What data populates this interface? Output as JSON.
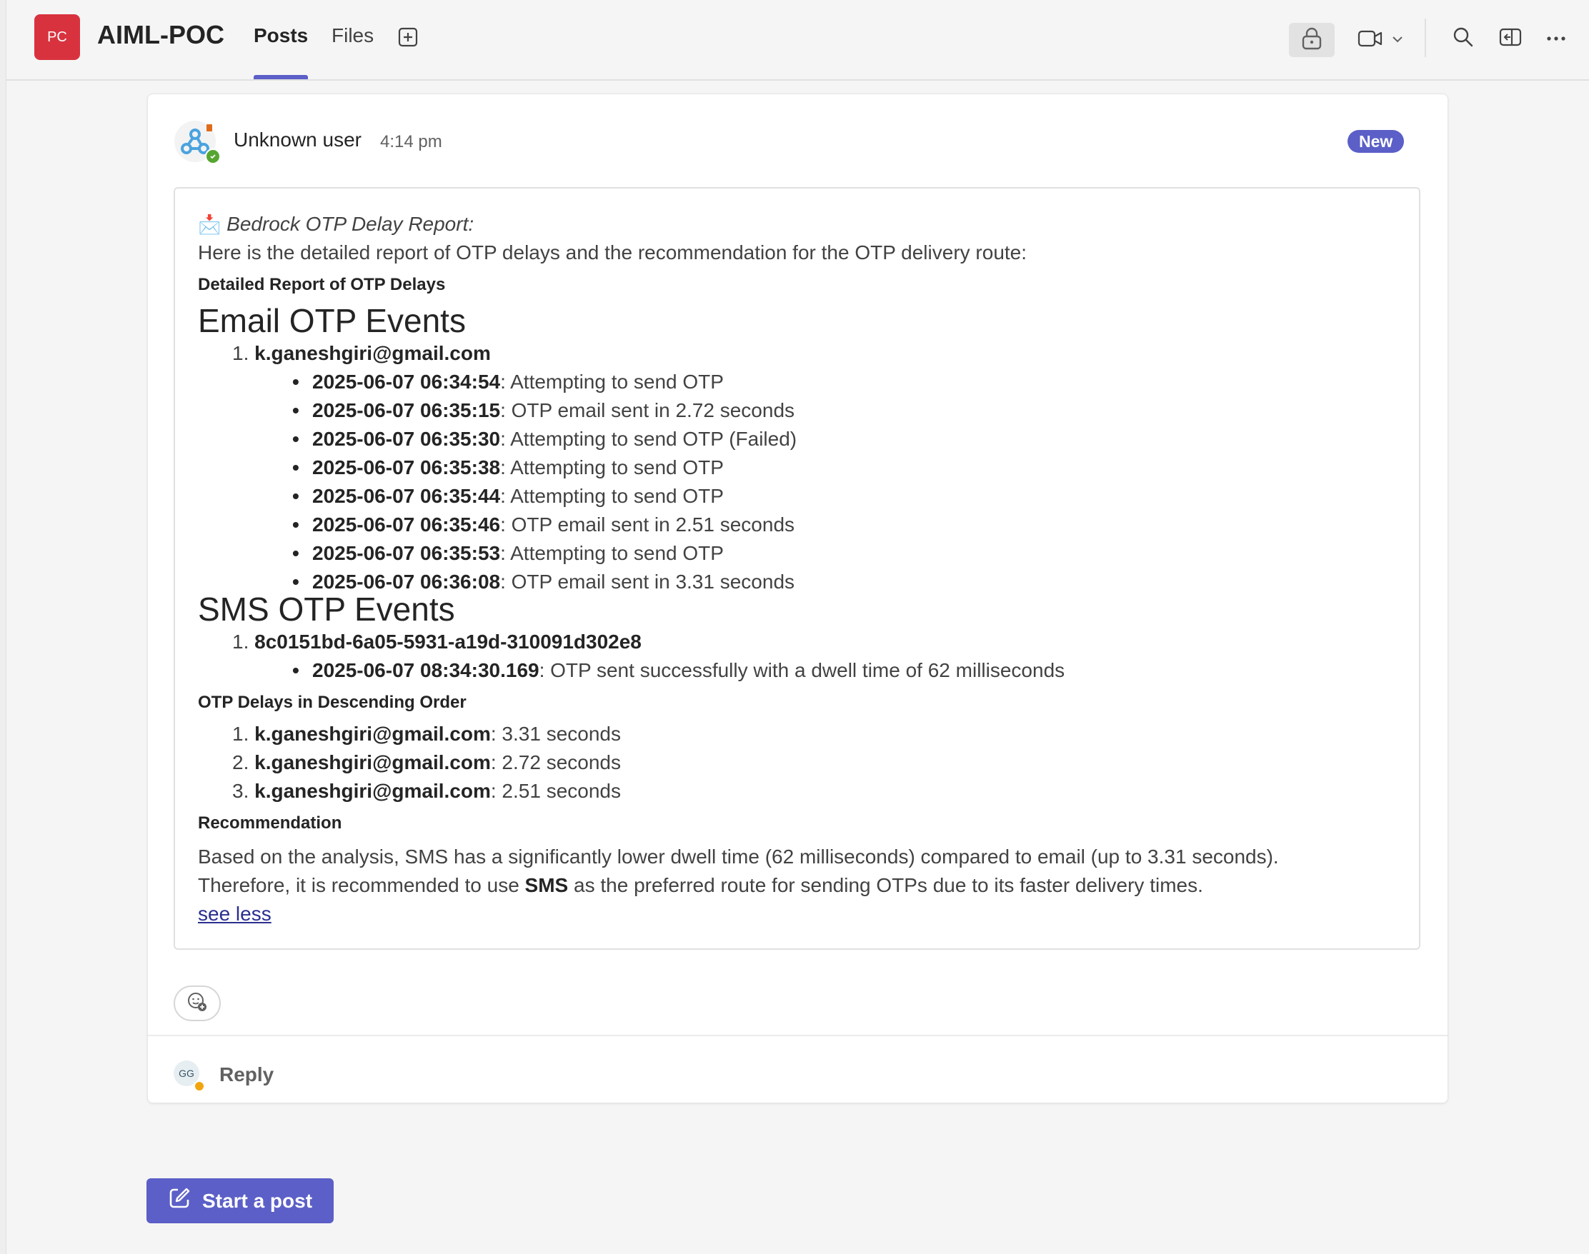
{
  "header": {
    "team_initials": "PC",
    "team_name": "AIML-POC",
    "tabs": [
      {
        "label": "Posts",
        "active": true
      },
      {
        "label": "Files",
        "active": false
      }
    ],
    "icons": [
      "add-tab-icon",
      "lock-icon",
      "video-icon",
      "chevron-down-icon",
      "search-icon",
      "side-panel-icon",
      "more-icon"
    ]
  },
  "post": {
    "author": "Unknown user",
    "time": "4:14 pm",
    "badge": "New",
    "title_emoji": "📩",
    "title": "Bedrock OTP Delay Report:",
    "intro": "Here is the detailed report of OTP delays and the recommendation for the OTP delivery route:",
    "section1_heading": "Detailed Report of OTP Delays",
    "email_heading": "Email OTP Events",
    "email_user_num": "1.",
    "email_user": "k.ganeshgiri@gmail.com",
    "email_events": [
      {
        "ts": "2025-06-07 06:34:54",
        "text": ": Attempting to send OTP"
      },
      {
        "ts": "2025-06-07 06:35:15",
        "text": ": OTP email sent in 2.72 seconds"
      },
      {
        "ts": "2025-06-07 06:35:30",
        "text": ": Attempting to send OTP (Failed)"
      },
      {
        "ts": "2025-06-07 06:35:38",
        "text": ": Attempting to send OTP"
      },
      {
        "ts": "2025-06-07 06:35:44",
        "text": ": Attempting to send OTP"
      },
      {
        "ts": "2025-06-07 06:35:46",
        "text": ": OTP email sent in 2.51 seconds"
      },
      {
        "ts": "2025-06-07 06:35:53",
        "text": ": Attempting to send OTP"
      },
      {
        "ts": "2025-06-07 06:36:08",
        "text": ": OTP email sent in 3.31 seconds"
      }
    ],
    "sms_heading": "SMS OTP Events",
    "sms_id_num": "1.",
    "sms_id": "8c0151bd-6a05-5931-a19d-310091d302e8",
    "sms_event": {
      "ts": "2025-06-07 08:34:30.169",
      "text": ": OTP sent successfully with a dwell time of 62 milliseconds"
    },
    "section2_heading": "OTP Delays in Descending Order",
    "delays": [
      {
        "num": "1.",
        "user": "k.ganeshgiri@gmail.com",
        "value": ": 3.31 seconds"
      },
      {
        "num": "2.",
        "user": "k.ganeshgiri@gmail.com",
        "value": ": 2.72 seconds"
      },
      {
        "num": "3.",
        "user": "k.ganeshgiri@gmail.com",
        "value": ": 2.51 seconds"
      }
    ],
    "section3_heading": "Recommendation",
    "rec_line1": "Based on the analysis, SMS has a significantly lower dwell time (62 milliseconds) compared to email (up to 3.31 seconds).",
    "rec_line2_pre": "Therefore, it is recommended to use ",
    "rec_line2_bold": "SMS",
    "rec_line2_post": " as the preferred route for sending OTPs due to its faster delivery times.",
    "see_less": "see less"
  },
  "reply": {
    "initials": "GG",
    "label": "Reply"
  },
  "start_post": "Start a post",
  "colors": {
    "accent": "#5b5fc7",
    "team_avatar": "#d9323f",
    "status_available": "#55a630"
  }
}
